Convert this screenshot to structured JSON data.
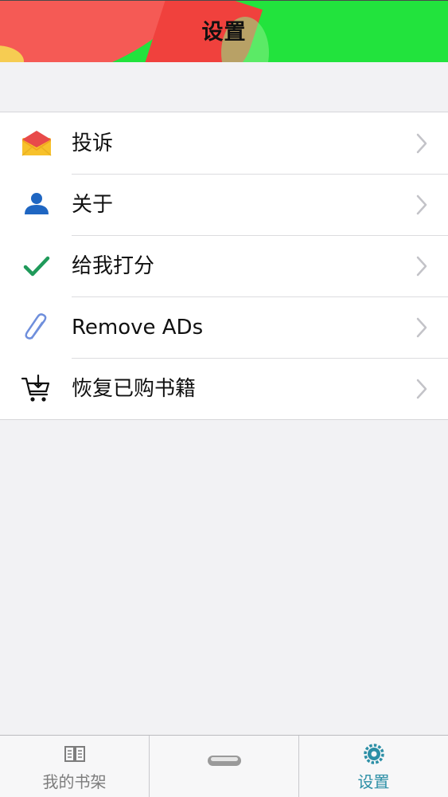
{
  "header": {
    "title": "设置"
  },
  "settings": {
    "items": [
      {
        "label": "投诉",
        "icon": "envelope-icon"
      },
      {
        "label": "关于",
        "icon": "person-icon"
      },
      {
        "label": "给我打分",
        "icon": "checkmark-icon"
      },
      {
        "label": "Remove ADs",
        "icon": "paperclip-icon"
      },
      {
        "label": "恢复已购书籍",
        "icon": "cart-download-icon"
      }
    ]
  },
  "tabbar": {
    "tabs": [
      {
        "label": "我的书架",
        "icon": "book-icon",
        "active": false
      },
      {
        "label": "",
        "icon": "home-button-icon",
        "active": false
      },
      {
        "label": "设置",
        "icon": "gear-icon",
        "active": true
      }
    ]
  },
  "colors": {
    "header_green": "#22e33d",
    "header_red": "#f55a55",
    "active_tab": "#2c8fa6",
    "inactive_tab": "#7d7d7d",
    "background": "#f2f2f4"
  }
}
